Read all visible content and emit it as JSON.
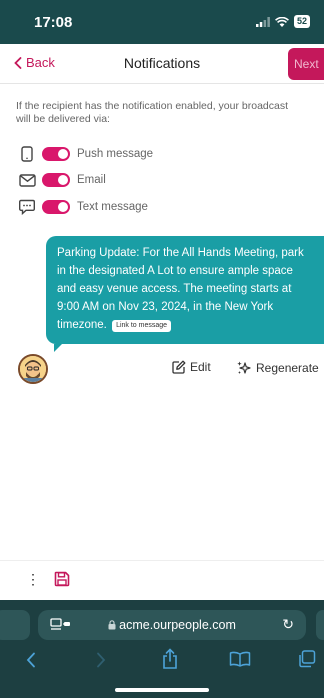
{
  "status_bar": {
    "time": "17:08",
    "battery": "52"
  },
  "header": {
    "back_label": "Back",
    "title": "Notifications",
    "next_label": "Next"
  },
  "intro_text": {
    "line1": "If the recipient has the notification enabled, your broadcast",
    "line2": "will be delivered via:"
  },
  "channels": [
    {
      "label": "Push message",
      "icon": "phone-icon",
      "enabled": true
    },
    {
      "label": "Email",
      "icon": "mail-icon",
      "enabled": true
    },
    {
      "label": "Text message",
      "icon": "chat-icon",
      "enabled": true
    }
  ],
  "message": {
    "text": "Parking Update: For the All Hands Meeting, park in the designated A Lot to ensure ample space and easy venue access. The meeting starts at 9:00 AM on Nov 23, 2024, in the New York timezone.",
    "link_label": "Link to message"
  },
  "actions": {
    "edit_label": "Edit",
    "regenerate_label": "Regenerate"
  },
  "browser": {
    "url": "acme.ourpeople.com"
  },
  "colors": {
    "accent": "#c4185b",
    "toggle": "#d9176b",
    "bubble": "#1a9ea5",
    "status_bar": "#1a4a4c",
    "browser_bar": "#1d3f41"
  }
}
